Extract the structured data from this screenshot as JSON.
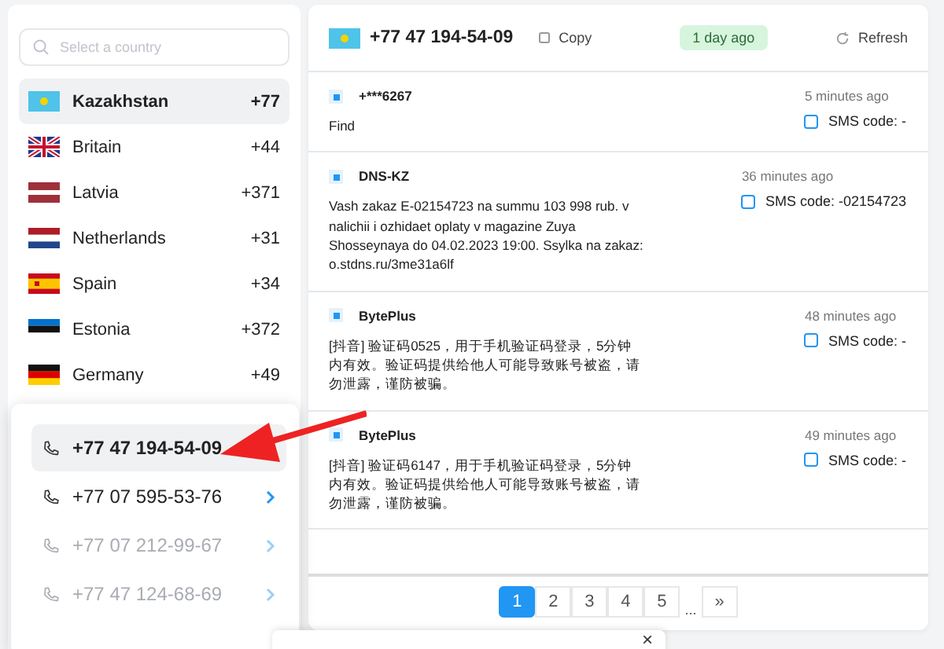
{
  "search": {
    "placeholder": "Select a country"
  },
  "countries": [
    {
      "kind": "kz",
      "name": "Kazakhstan",
      "code": "+77",
      "selected": true
    },
    {
      "kind": "gb",
      "name": "Britain",
      "code": "+44",
      "selected": false
    },
    {
      "kind": "lv",
      "name": "Latvia",
      "code": "+371",
      "selected": false
    },
    {
      "kind": "nl",
      "name": "Netherlands",
      "code": "+31",
      "selected": false
    },
    {
      "kind": "es",
      "name": "Spain",
      "code": "+34",
      "selected": false
    },
    {
      "kind": "ee",
      "name": "Estonia",
      "code": "+372",
      "selected": false
    },
    {
      "kind": "de",
      "name": "Germany",
      "code": "+49",
      "selected": false
    }
  ],
  "numbers": [
    {
      "number": "+77 47 194-54-09",
      "selected": true,
      "disabled": false
    },
    {
      "number": "+77 07 595-53-76",
      "selected": false,
      "disabled": false
    },
    {
      "number": "+77 07 212-99-67",
      "selected": false,
      "disabled": true
    },
    {
      "number": "+77 47 124-68-69",
      "selected": false,
      "disabled": true
    }
  ],
  "header": {
    "flag": {
      "kind": "kz"
    },
    "number": "+77 47 194-54-09",
    "copy": "Copy",
    "badge": "1 day ago",
    "refresh": "Refresh"
  },
  "messages": [
    {
      "sender": "+***6267",
      "time": "5 minutes ago",
      "text": "Find",
      "code": "SMS code: -"
    },
    {
      "sender": "DNS-KZ",
      "time": "36 minutes ago",
      "text": "Vash zakaz E-02154723 na summu 103 998 rub. v nalichii i ozhidaet oplaty v magazine Zuya Shosseynaya do 04.02.2023 19:00. Ssylka na zakaz: o.stdns.ru/3me31a6lf",
      "code": "SMS code: -02154723"
    },
    {
      "sender": "BytePlus",
      "time": "48 minutes ago",
      "text": "[抖音] 验证码0525，用于手机验证码登录，5分钟内有效。验证码提供给他人可能导致账号被盗，请勿泄露，谨防被骗。",
      "code": "SMS code: -"
    },
    {
      "sender": "BytePlus",
      "time": "49 minutes ago",
      "text": "[抖音] 验证码6147，用于手机验证码登录，5分钟内有效。验证码提供给他人可能导致账号被盗，请勿泄露，谨防被骗。",
      "code": "SMS code: -"
    }
  ],
  "pagination": [
    {
      "kind": "page",
      "label": "1",
      "selected": true
    },
    {
      "kind": "page",
      "label": "2",
      "selected": false
    },
    {
      "kind": "page",
      "label": "3",
      "selected": false
    },
    {
      "kind": "page",
      "label": "4",
      "selected": false
    },
    {
      "kind": "page",
      "label": "5",
      "selected": false
    },
    {
      "kind": "gap",
      "label": "..."
    },
    {
      "kind": "page",
      "label": "»",
      "selected": false
    }
  ],
  "cookie_bar": {
    "close": "×"
  }
}
